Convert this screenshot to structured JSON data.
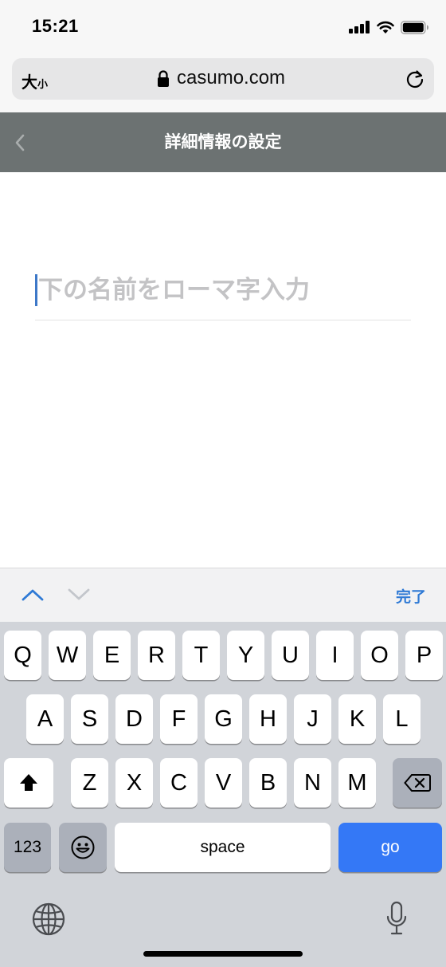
{
  "status": {
    "time": "15:21"
  },
  "browser": {
    "text_size_large": "大",
    "text_size_small": "小",
    "url": "casumo.com"
  },
  "header": {
    "title": "詳細情報の設定"
  },
  "form": {
    "name_placeholder": "下の名前をローマ字入力",
    "name_value": ""
  },
  "accessory": {
    "done_label": "完了"
  },
  "keyboard": {
    "row1": [
      "Q",
      "W",
      "E",
      "R",
      "T",
      "Y",
      "U",
      "I",
      "O",
      "P"
    ],
    "row2": [
      "A",
      "S",
      "D",
      "F",
      "G",
      "H",
      "J",
      "K",
      "L"
    ],
    "row3": [
      "Z",
      "X",
      "C",
      "V",
      "B",
      "N",
      "M"
    ],
    "numbers_label": "123",
    "space_label": "space",
    "go_label": "go",
    "icons": [
      "shift-icon",
      "backspace-icon",
      "emoji-icon",
      "globe-icon",
      "microphone-icon"
    ]
  },
  "colors": {
    "header_bg": "#6c7272",
    "accent": "#2f7ad5",
    "go_key": "#3478f6"
  }
}
